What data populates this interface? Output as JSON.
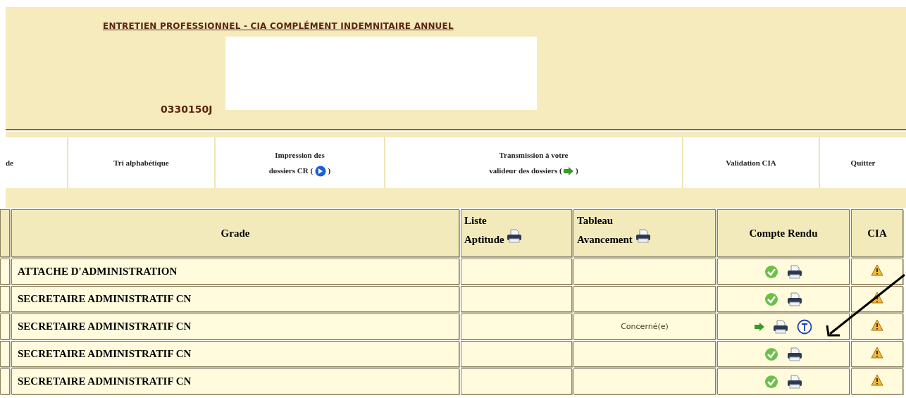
{
  "header": {
    "title": "ENTRETIEN PROFESSIONNEL - CIA COMPLÉMENT INDEMNITAIRE ANNUEL",
    "code": "0330150J"
  },
  "nav": [
    {
      "lines": [
        "de"
      ]
    },
    {
      "lines": [
        "Tri alphabétique"
      ]
    },
    {
      "lines": [
        "Impression des",
        "dossiers CR ("
      ],
      "icon": {
        "kind": "circle-arrow"
      },
      "tail": ")"
    },
    {
      "lines": [
        "Transmission à votre",
        "valideur des dossiers ("
      ],
      "icon": {
        "kind": "arrow"
      },
      "tail": ")"
    },
    {
      "lines": [
        "Validation CIA"
      ]
    },
    {
      "lines": [
        "Quitter"
      ]
    }
  ],
  "table": {
    "columns": [
      {
        "label": "Grade"
      },
      {
        "label": "Liste Aptitude",
        "icon": {
          "kind": "printer"
        }
      },
      {
        "label": "Tableau Avancement",
        "icon": {
          "kind": "printer"
        }
      },
      {
        "label": "Compte Rendu"
      },
      {
        "label": "CIA"
      }
    ],
    "rows": [
      {
        "grade": "ATTACHE D'ADMINISTRATION",
        "tableau": "",
        "compte_rendu": [
          {
            "kind": "check"
          },
          {
            "kind": "printer"
          }
        ],
        "cia": {
          "kind": "warning"
        }
      },
      {
        "grade": "SECRETAIRE ADMINISTRATIF CN",
        "tableau": "",
        "compte_rendu": [
          {
            "kind": "check"
          },
          {
            "kind": "printer"
          }
        ],
        "cia": {
          "kind": "warning"
        }
      },
      {
        "grade": "SECRETAIRE ADMINISTRATIF CN",
        "tableau": "Concerné(e)",
        "compte_rendu": [
          {
            "kind": "arrow"
          },
          {
            "kind": "printer"
          },
          {
            "kind": "t-circle"
          }
        ],
        "cia": {
          "kind": "warning"
        }
      },
      {
        "grade": "SECRETAIRE ADMINISTRATIF CN",
        "tableau": "",
        "compte_rendu": [
          {
            "kind": "check"
          },
          {
            "kind": "printer"
          }
        ],
        "cia": {
          "kind": "warning"
        }
      },
      {
        "grade": "SECRETAIRE ADMINISTRATIF CN",
        "tableau": "",
        "compte_rendu": [
          {
            "kind": "check"
          },
          {
            "kind": "printer"
          }
        ],
        "cia": {
          "kind": "warning"
        }
      }
    ]
  }
}
